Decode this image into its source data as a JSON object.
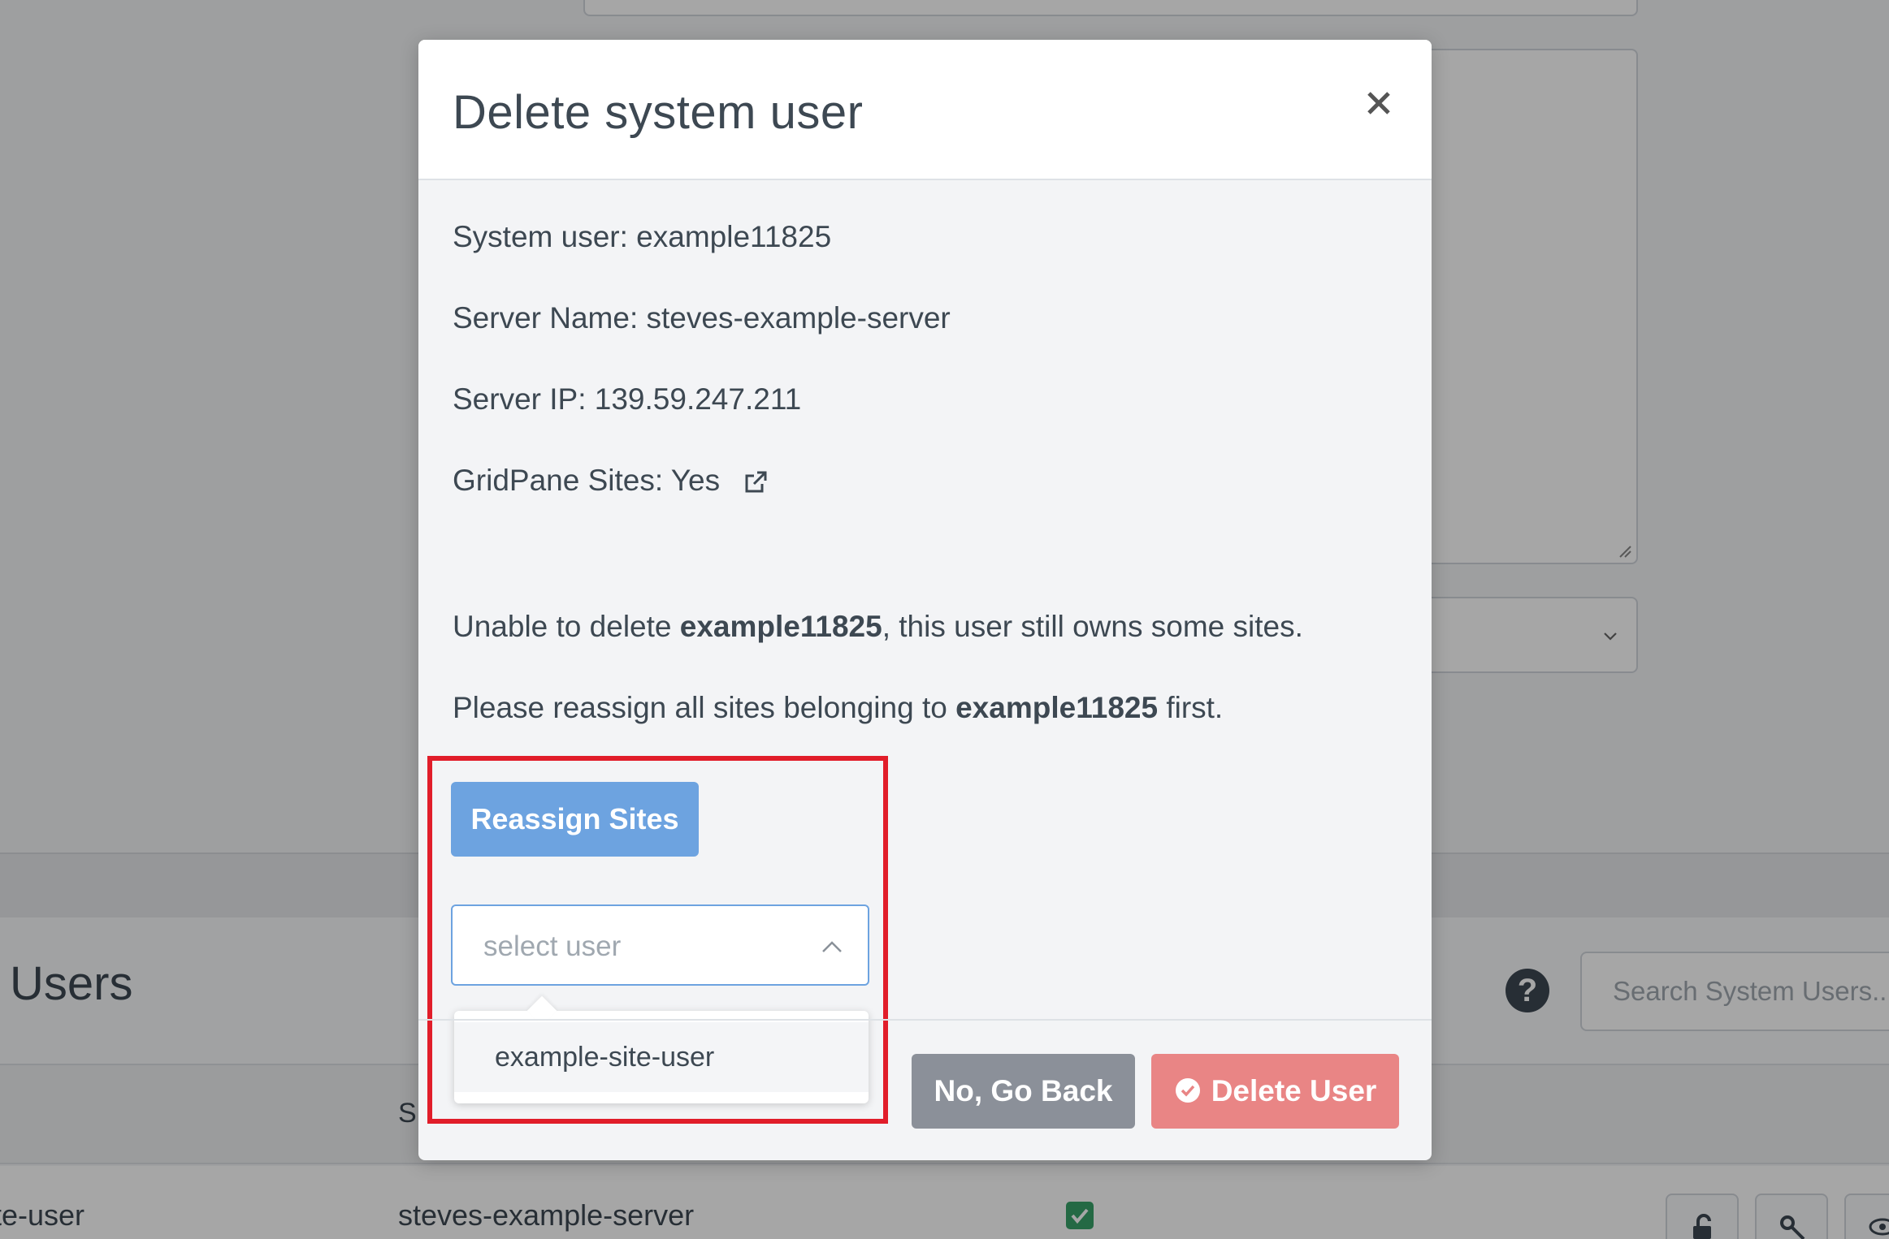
{
  "background": {
    "section_title": "Users",
    "search": {
      "placeholder": "Search System Users..."
    },
    "table": {
      "server_header": "S",
      "row": {
        "user": "te-user",
        "server": "steves-example-server"
      }
    }
  },
  "modal": {
    "title": "Delete system user",
    "info": {
      "system_user": "System user: example11825",
      "server_name": "Server Name: steves-example-server",
      "server_ip": "Server IP: 139.59.247.211",
      "gridpane_sites": "GridPane Sites: Yes"
    },
    "message": {
      "line1_prefix": "Unable to delete ",
      "line1_user": "example11825",
      "line1_suffix": ", this user still owns some sites.",
      "line2_prefix": "Please reassign all sites belonging to ",
      "line2_user": "example11825",
      "line2_suffix": " first."
    },
    "reassign_label": "Reassign Sites",
    "select": {
      "placeholder": "select user",
      "options": [
        "example-site-user"
      ]
    },
    "buttons": {
      "go_back": "No, Go Back",
      "delete": "Delete User"
    }
  },
  "colors": {
    "primary": "#6da3e0",
    "danger": "#e98585",
    "secondary": "#8b9099",
    "highlight": "#e11d2a"
  }
}
